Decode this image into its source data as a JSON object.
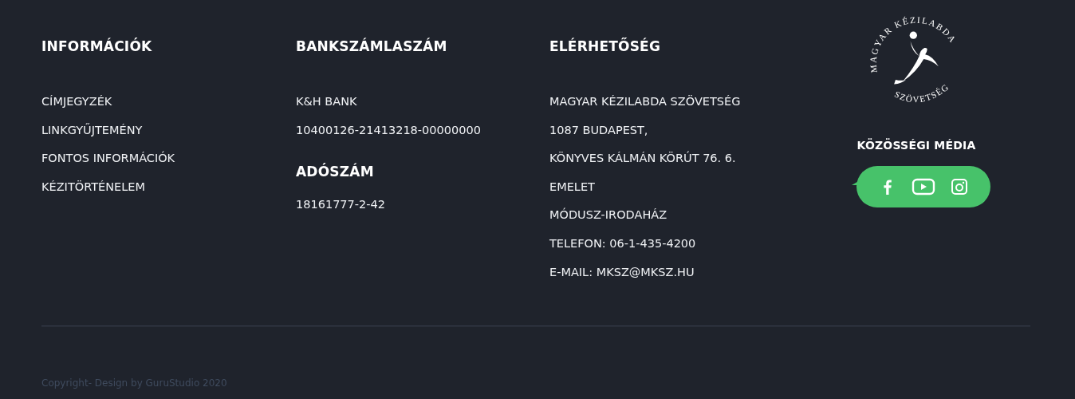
{
  "columns": [
    {
      "title": "INFORMÁCIÓK",
      "sections": [
        {
          "lines": [
            "CÍMJEGYZÉK",
            "LINKGYŰJTEMÉNY",
            "FONTOS INFORMÁCIÓK",
            "KÉZITÖRTÉNELEM"
          ]
        }
      ]
    },
    {
      "title": "BANKSZÁMLASZÁM",
      "sections": [
        {
          "lines": [
            "K&H BANK",
            "10400126-21413218-00000000"
          ]
        },
        {
          "heading": "ADÓSZÁM",
          "lines": [
            "18161777-2-42"
          ]
        }
      ]
    },
    {
      "title": "ELÉRHETŐSÉG",
      "sections": [
        {
          "lines": [
            "MAGYAR KÉZILABDA SZÖVETSÉG",
            "1087 BUDAPEST,",
            "KÖNYVES KÁLMÁN KÖRÚT 76. 6.",
            "EMELET",
            "MÓDUSZ-IRODAHÁZ",
            "TELEFON: 06-1-435-4200",
            "E-MAIL: MKSZ@MKSZ.HU"
          ]
        }
      ]
    }
  ],
  "logo": {
    "top_text": "MAGYAR KÉZILABDA",
    "bottom_text": "SZÖVETSÉG"
  },
  "social": {
    "title": "KÖZÖSSÉGI MÉDIA",
    "icons": [
      {
        "kind": "facebook"
      },
      {
        "kind": "youtube"
      },
      {
        "kind": "instagram"
      }
    ]
  },
  "copyright": "Copyright- Design by GuruStudio 2020"
}
